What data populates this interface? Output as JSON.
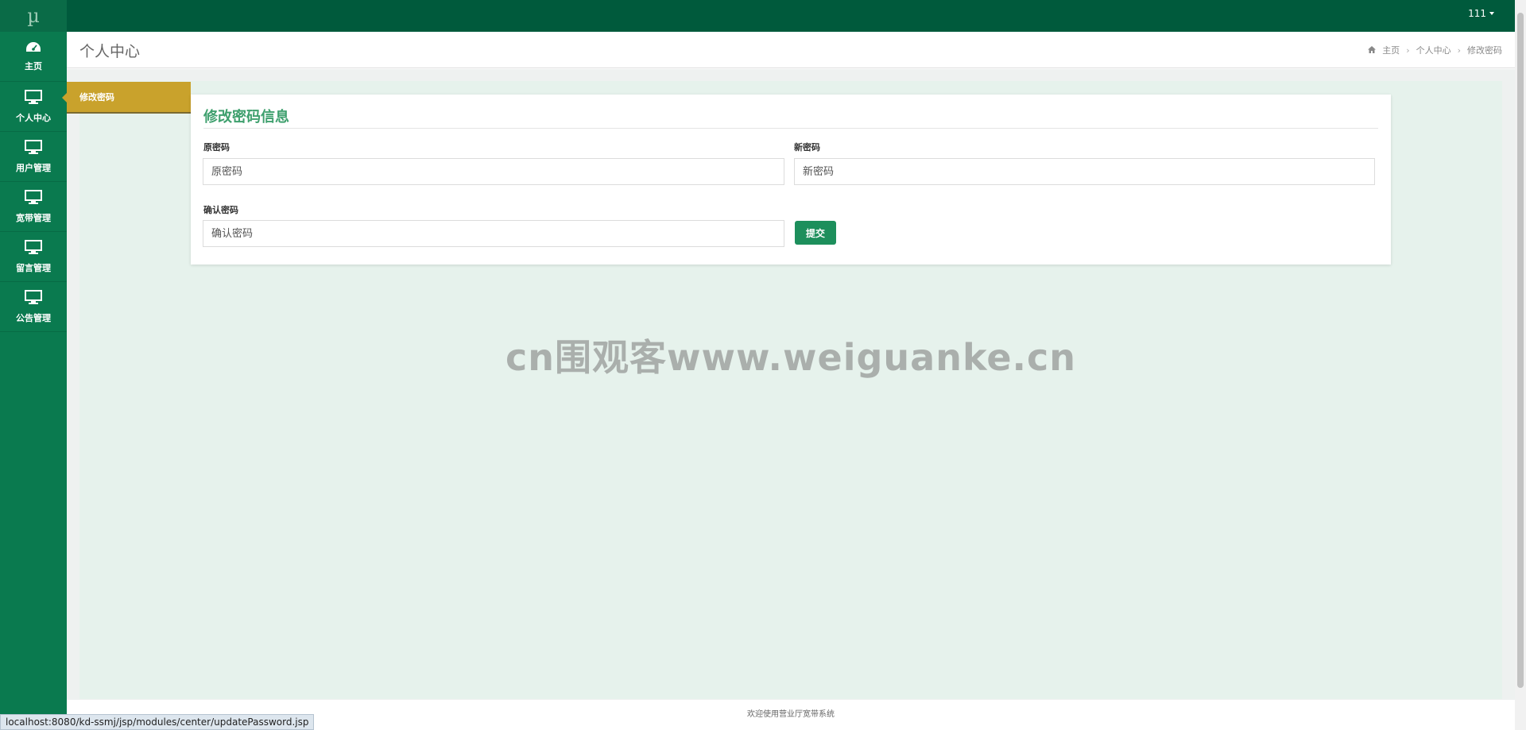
{
  "app": {
    "logo": "µ",
    "user_label": "111"
  },
  "sidebar": {
    "items": [
      {
        "label": "主页",
        "icon": "dashboard-icon"
      },
      {
        "label": "个人中心",
        "icon": "monitor-icon"
      },
      {
        "label": "用户管理",
        "icon": "monitor-icon"
      },
      {
        "label": "宽带管理",
        "icon": "monitor-icon"
      },
      {
        "label": "留言管理",
        "icon": "monitor-icon"
      },
      {
        "label": "公告管理",
        "icon": "monitor-icon"
      }
    ]
  },
  "header": {
    "title": "个人中心",
    "breadcrumb": [
      "主页",
      "个人中心",
      "修改密码"
    ]
  },
  "submenu": {
    "active_item": "修改密码"
  },
  "form": {
    "title": "修改密码信息",
    "old_password": {
      "label": "原密码",
      "placeholder": "原密码"
    },
    "new_password": {
      "label": "新密码",
      "placeholder": "新密码"
    },
    "confirm_password": {
      "label": "确认密码",
      "placeholder": "确认密码"
    },
    "submit_label": "提交"
  },
  "watermark": "cn围观客www.weiguanke.cn",
  "footer": "欢迎使用营业厅宽带系统",
  "status_url": "localhost:8080/kd-ssmj/jsp/modules/center/updatePassword.jsp",
  "colors": {
    "topbar": "#005a3c",
    "sidebar": "#0a7a4f",
    "accent": "#3fa06e",
    "submenu_active": "#c9a22c",
    "button": "#1d8f5c"
  }
}
